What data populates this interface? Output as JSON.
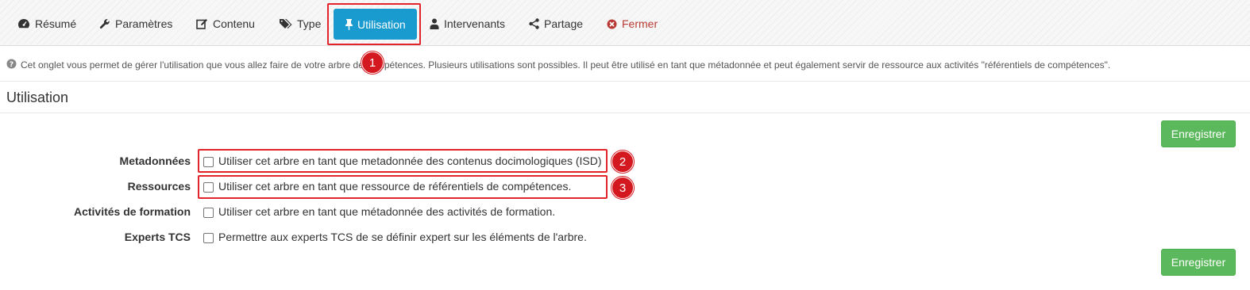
{
  "tabs": [
    {
      "label": "Résumé",
      "icon": "dashboard-icon"
    },
    {
      "label": "Paramètres",
      "icon": "wrench-icon"
    },
    {
      "label": "Contenu",
      "icon": "edit-icon"
    },
    {
      "label": "Type",
      "icon": "tags-icon"
    },
    {
      "label": "Utilisation",
      "icon": "pin-icon",
      "active": true
    },
    {
      "label": "Intervenants",
      "icon": "user-icon"
    },
    {
      "label": "Partage",
      "icon": "share-icon"
    },
    {
      "label": "Fermer",
      "icon": "close-circle-icon"
    }
  ],
  "info_text": "Cet onglet vous permet de gérer l'utilisation que vous allez faire de votre arbre de compétences. Plusieurs utilisations sont possibles. Il peut être utilisé en tant que métadonnée et peut également servir de ressource aux activités \"référentiels de compétences\".",
  "section_title": "Utilisation",
  "save_label": "Enregistrer",
  "rows": [
    {
      "label": "Metadonnées",
      "text": "Utiliser cet arbre en tant que metadonnée des contenus docimologiques (ISD)",
      "checked": false
    },
    {
      "label": "Ressources",
      "text": "Utiliser cet arbre en tant que ressource de référentiels de compétences.",
      "checked": false
    },
    {
      "label": "Activités de formation",
      "text": "Utiliser cet arbre en tant que métadonnée des activités de formation.",
      "checked": false
    },
    {
      "label": "Experts TCS",
      "text": "Permettre aux experts TCS de se définir expert sur les éléments de l'arbre.",
      "checked": false
    }
  ],
  "callouts": [
    "1",
    "2",
    "3"
  ],
  "colors": {
    "accent": "#1a9bd0",
    "save": "#5cb85c",
    "danger": "#b93b36",
    "callout": "#d3191f"
  }
}
